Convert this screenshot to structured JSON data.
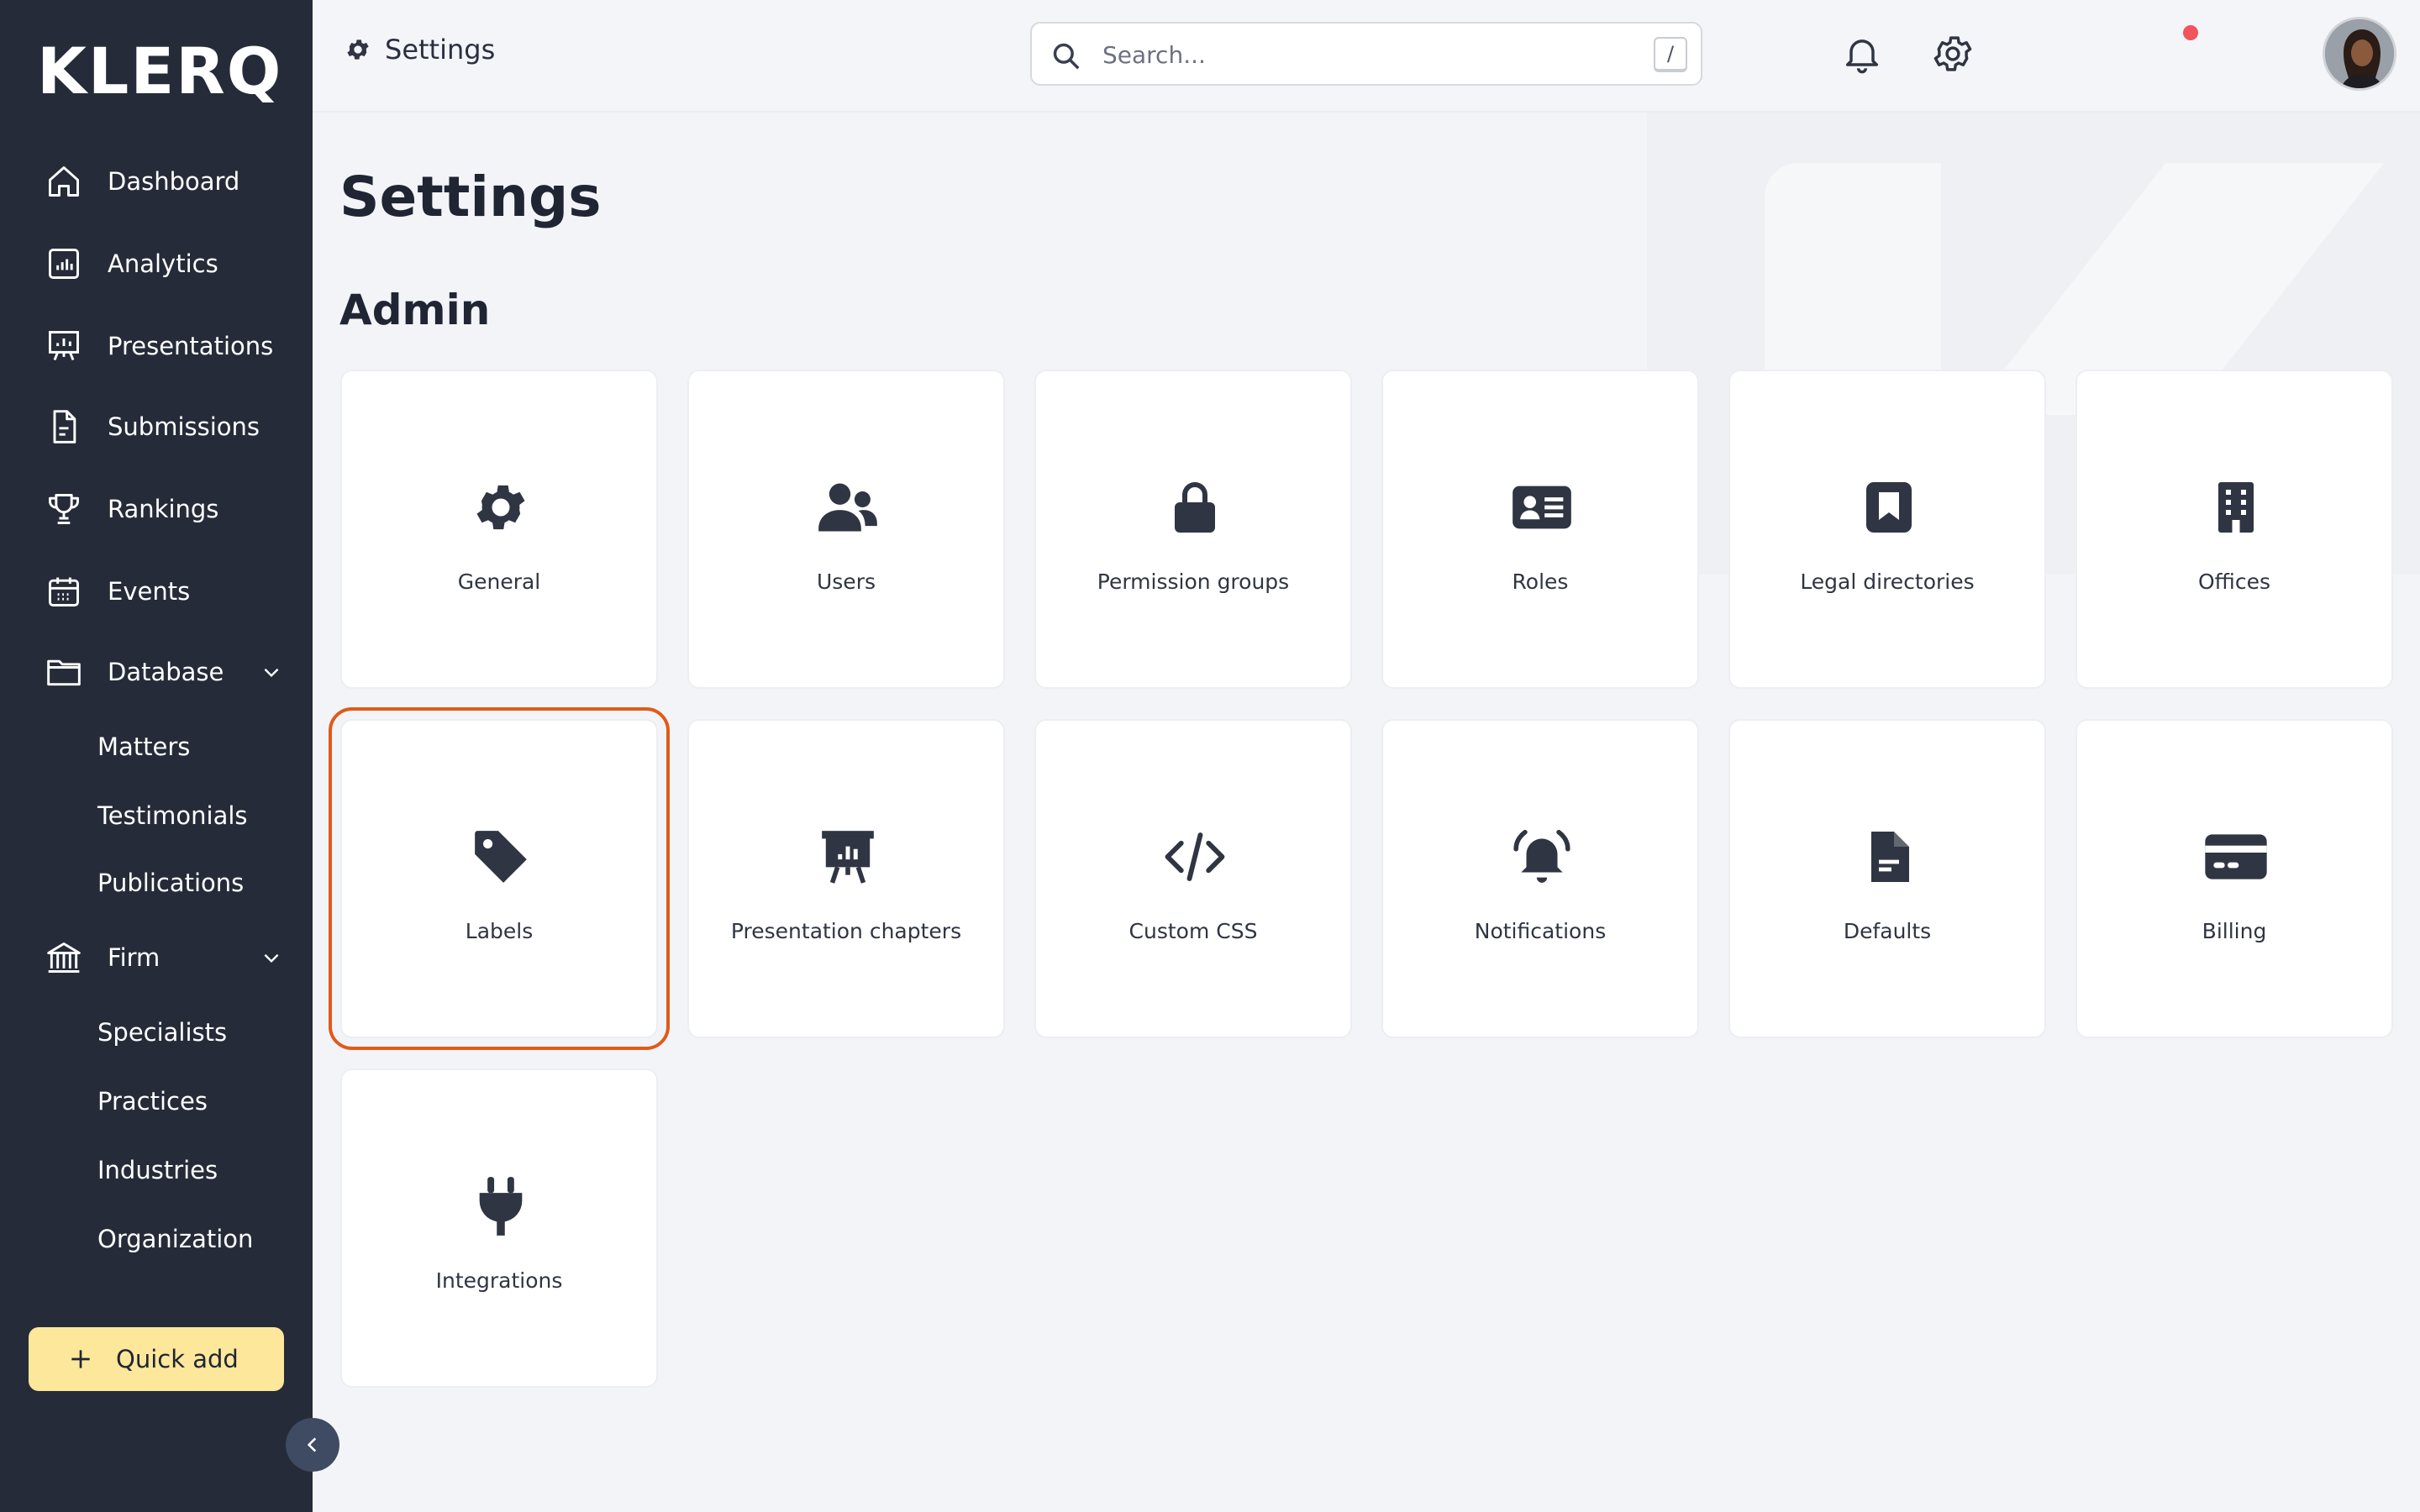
{
  "app": {
    "logo": "KLERQ",
    "accent_color": "#fde79a",
    "sidebar_bg": "#252b38",
    "selected_outline_color": "#e05a1a"
  },
  "sidebar": {
    "items": [
      {
        "label": "Dashboard",
        "icon": "home-icon"
      },
      {
        "label": "Analytics",
        "icon": "bar-chart-icon"
      },
      {
        "label": "Presentations",
        "icon": "presentation-icon"
      },
      {
        "label": "Submissions",
        "icon": "document-icon"
      },
      {
        "label": "Rankings",
        "icon": "trophy-icon"
      },
      {
        "label": "Events",
        "icon": "calendar-icon"
      },
      {
        "label": "Database",
        "icon": "folder-icon",
        "expanded": true
      },
      {
        "label": "Firm",
        "icon": "bank-icon",
        "expanded": true
      }
    ],
    "database_children": [
      "Matters",
      "Testimonials",
      "Publications"
    ],
    "firm_children": [
      "Specialists",
      "Practices",
      "Industries",
      "Organization"
    ],
    "quick_add": "Quick add"
  },
  "topbar": {
    "breadcrumb": "Settings",
    "search_placeholder": "Search...",
    "search_shortcut": "/",
    "has_notification": true
  },
  "main": {
    "title": "Settings",
    "section": "Admin",
    "cards": [
      {
        "label": "General",
        "icon": "gear-icon"
      },
      {
        "label": "Users",
        "icon": "users-icon"
      },
      {
        "label": "Permission groups",
        "icon": "lock-icon"
      },
      {
        "label": "Roles",
        "icon": "id-card-icon"
      },
      {
        "label": "Legal directories",
        "icon": "bookmark-icon"
      },
      {
        "label": "Offices",
        "icon": "building-icon"
      },
      {
        "label": "Labels",
        "icon": "tag-icon",
        "selected": true
      },
      {
        "label": "Presentation chapters",
        "icon": "presentation-chart-icon"
      },
      {
        "label": "Custom CSS",
        "icon": "code-icon"
      },
      {
        "label": "Notifications",
        "icon": "bell-ring-icon"
      },
      {
        "label": "Defaults",
        "icon": "file-icon"
      },
      {
        "label": "Billing",
        "icon": "credit-card-icon"
      },
      {
        "label": "Integrations",
        "icon": "plug-icon"
      }
    ]
  }
}
